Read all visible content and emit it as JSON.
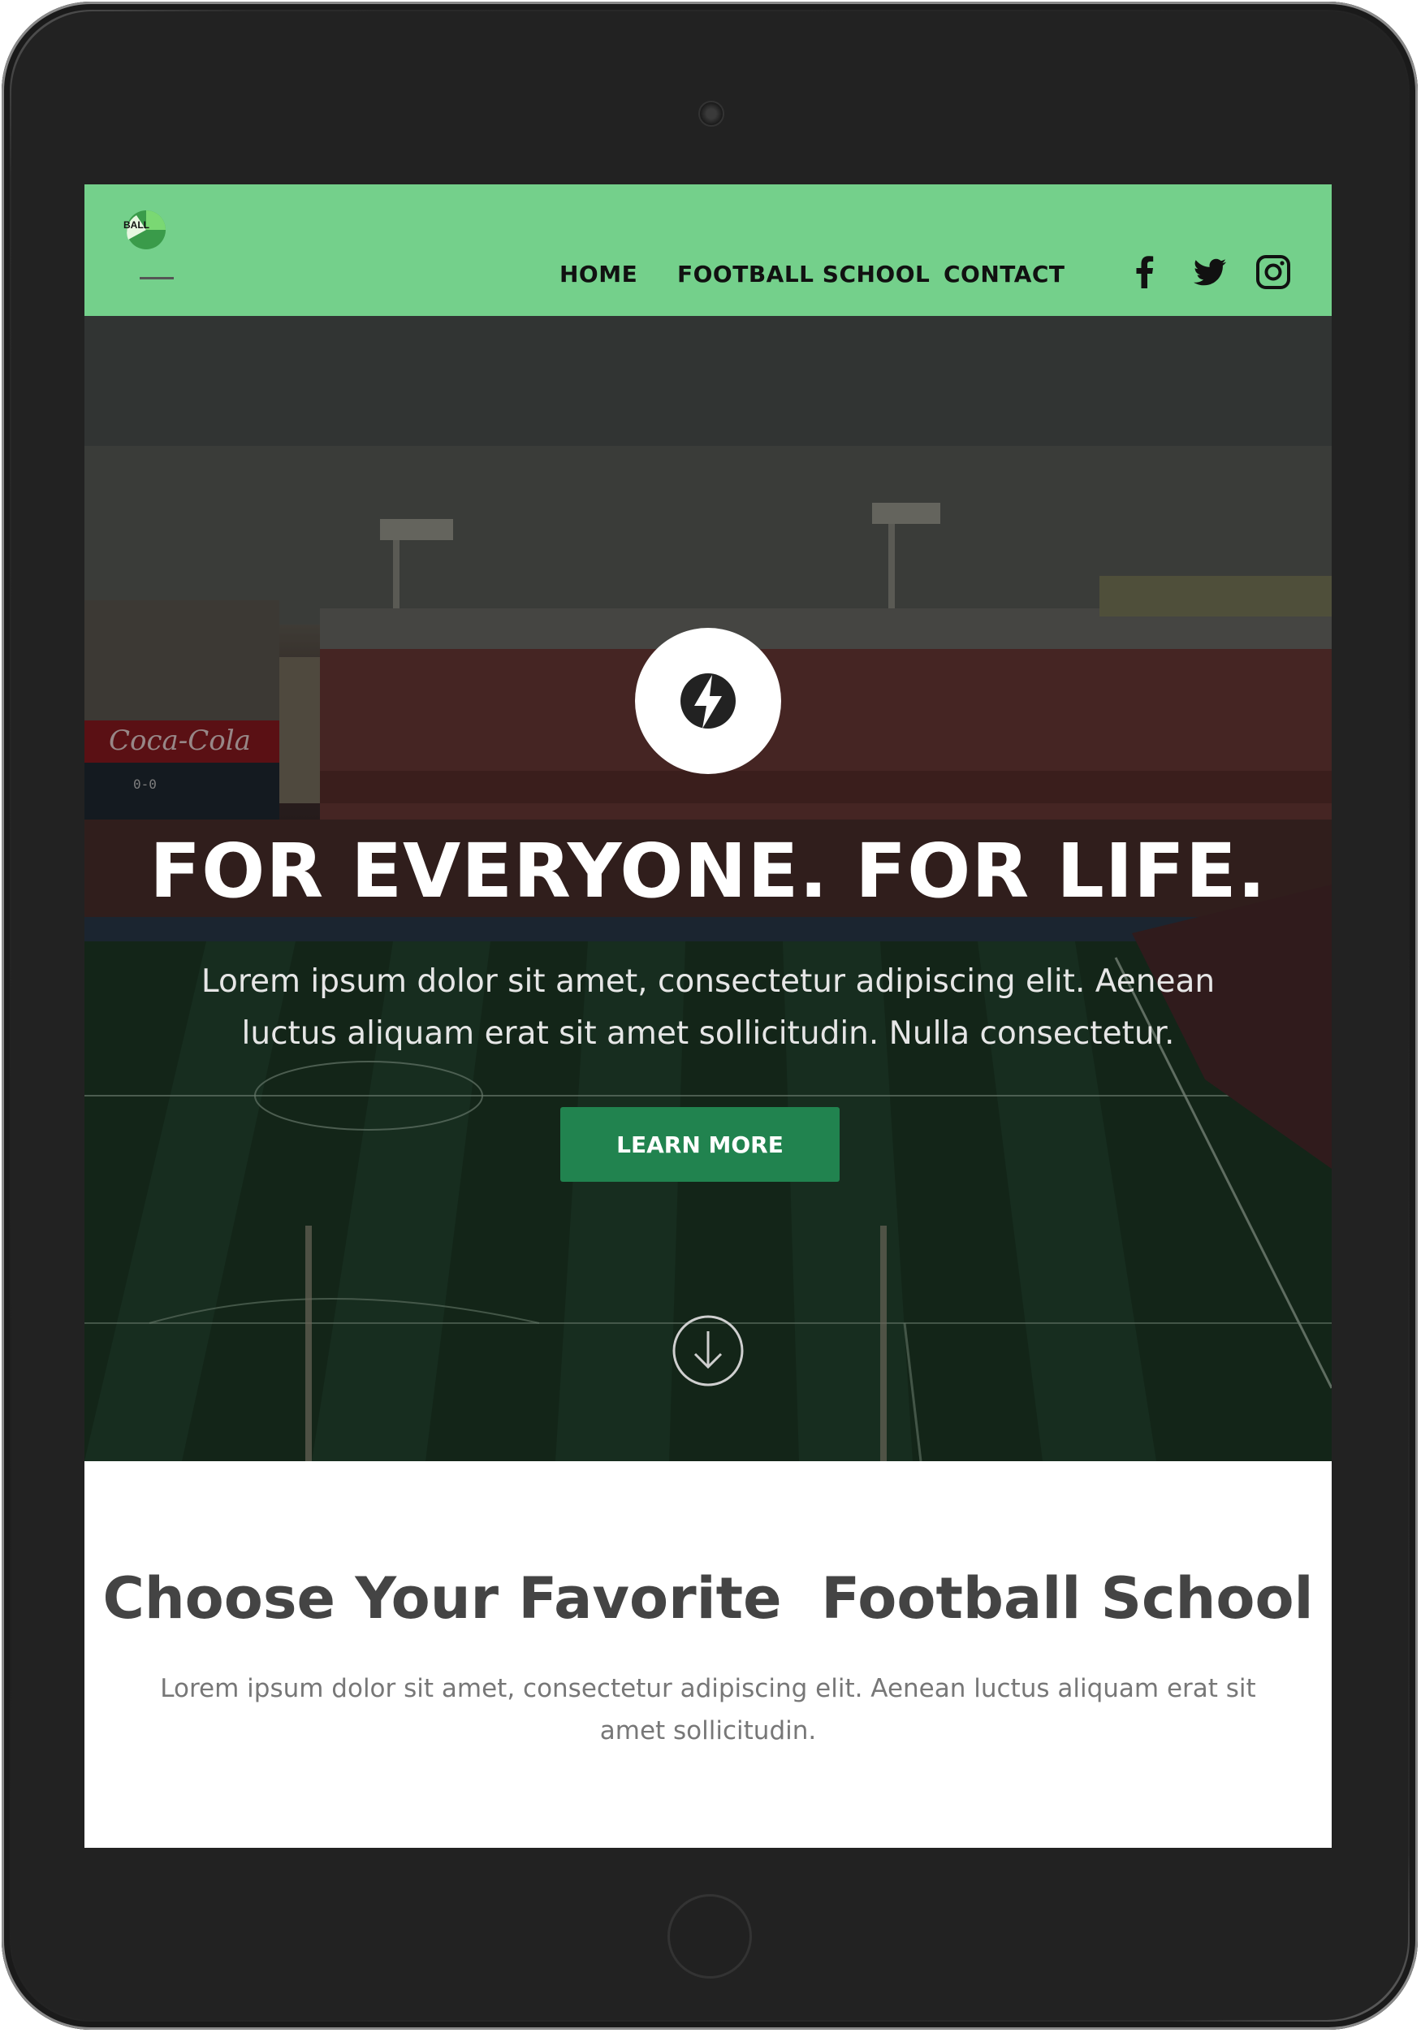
{
  "brand": {
    "logo_text": "BALL",
    "accent_color": "#74d08b",
    "button_color": "#21834f"
  },
  "nav": {
    "items": [
      {
        "label": "HOME"
      },
      {
        "label": "FOOTBALL SCHOOL"
      },
      {
        "label": "CONTACT"
      }
    ],
    "social": [
      "facebook-icon",
      "twitter-icon",
      "instagram-icon"
    ]
  },
  "hero": {
    "title": "FOR EVERYONE. FOR LIFE.",
    "subtitle": "Lorem ipsum dolor sit amet, consectetur adipiscing elit. Aenean luctus aliquam erat sit amet sollicitudin. Nulla consectetur.",
    "button_label": "LEARN MORE",
    "banner_text": "Coca-Cola",
    "scoreboard_text": "0-0"
  },
  "section": {
    "title": "Choose Your Favorite  Football School",
    "subtitle": "Lorem ipsum dolor sit amet, consectetur adipiscing elit. Aenean luctus aliquam erat sit amet sollicitudin."
  }
}
